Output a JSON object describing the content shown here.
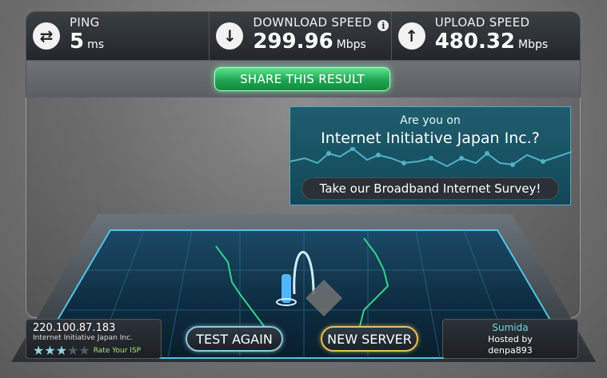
{
  "header": {
    "ping": {
      "label": "PING",
      "value": "5",
      "unit": "ms",
      "icon": "swap-arrows-icon"
    },
    "download": {
      "label": "DOWNLOAD SPEED",
      "value": "299.96",
      "unit": "Mbps",
      "icon": "down-arrow-icon",
      "info_icon": "i"
    },
    "upload": {
      "label": "UPLOAD SPEED",
      "value": "480.32",
      "unit": "Mbps",
      "icon": "up-arrow-icon"
    }
  },
  "share": {
    "label": "SHARE THIS RESULT"
  },
  "survey": {
    "ask": "Are you on",
    "isp": "Internet Initiative Japan Inc.?",
    "button": "Take our Broadband Internet Survey!"
  },
  "client": {
    "ip": "220.100.87.183",
    "isp": "Internet Initiative Japan Inc.",
    "rating_stars": 3,
    "rating_max": 5,
    "rate_label": "Rate Your ISP"
  },
  "buttons": {
    "test_again": "TEST AGAIN",
    "new_server": "NEW SERVER"
  },
  "server": {
    "city": "Sumida",
    "hosted_line1": "Hosted by",
    "host": "denpa893"
  },
  "colors": {
    "accent_green": "#1fa552",
    "accent_cyan": "#6fd3e6",
    "accent_gold": "#e7c052"
  }
}
